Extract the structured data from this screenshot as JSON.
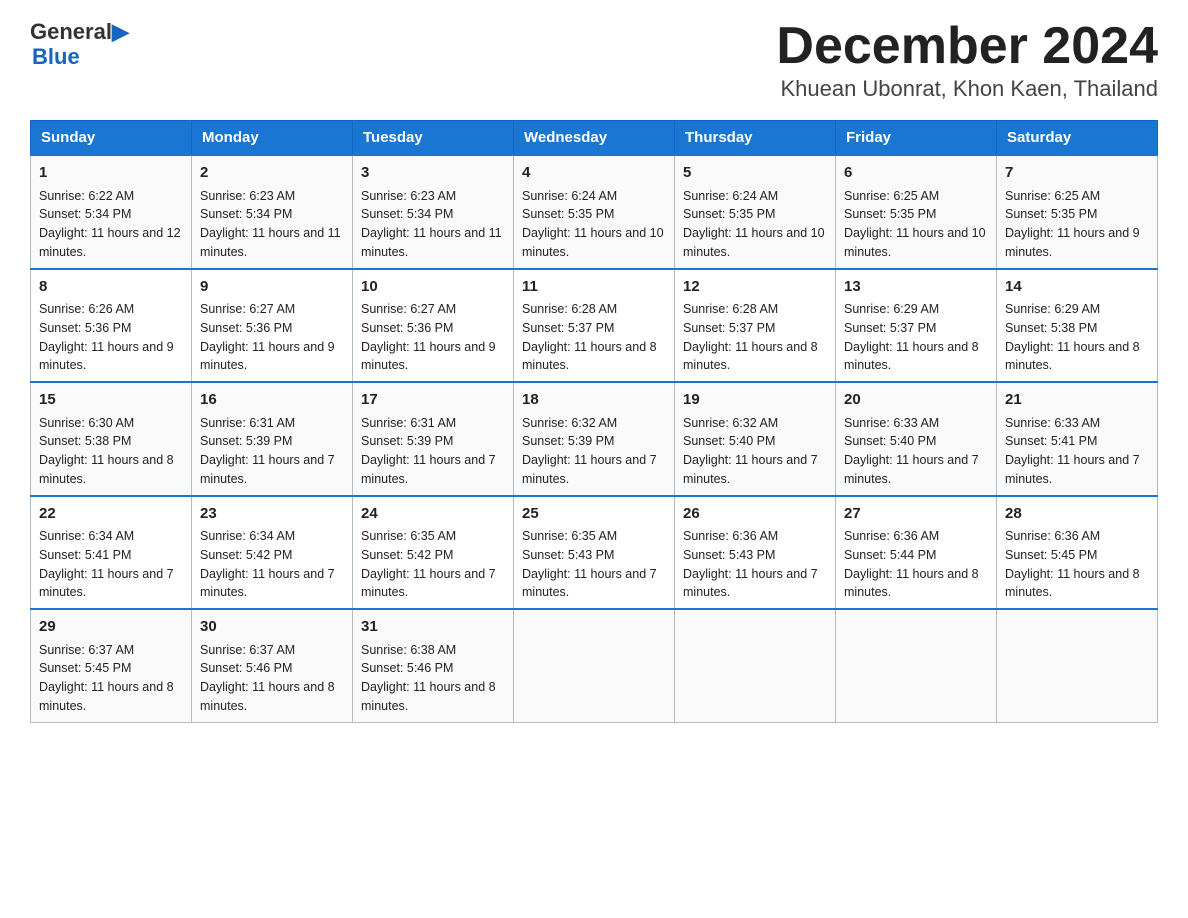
{
  "header": {
    "logo_line1": "General",
    "logo_line2": "Blue",
    "month_title": "December 2024",
    "location": "Khuean Ubonrat, Khon Kaen, Thailand"
  },
  "days_of_week": [
    "Sunday",
    "Monday",
    "Tuesday",
    "Wednesday",
    "Thursday",
    "Friday",
    "Saturday"
  ],
  "weeks": [
    [
      {
        "day": "1",
        "sunrise": "6:22 AM",
        "sunset": "5:34 PM",
        "daylight": "11 hours and 12 minutes."
      },
      {
        "day": "2",
        "sunrise": "6:23 AM",
        "sunset": "5:34 PM",
        "daylight": "11 hours and 11 minutes."
      },
      {
        "day": "3",
        "sunrise": "6:23 AM",
        "sunset": "5:34 PM",
        "daylight": "11 hours and 11 minutes."
      },
      {
        "day": "4",
        "sunrise": "6:24 AM",
        "sunset": "5:35 PM",
        "daylight": "11 hours and 10 minutes."
      },
      {
        "day": "5",
        "sunrise": "6:24 AM",
        "sunset": "5:35 PM",
        "daylight": "11 hours and 10 minutes."
      },
      {
        "day": "6",
        "sunrise": "6:25 AM",
        "sunset": "5:35 PM",
        "daylight": "11 hours and 10 minutes."
      },
      {
        "day": "7",
        "sunrise": "6:25 AM",
        "sunset": "5:35 PM",
        "daylight": "11 hours and 9 minutes."
      }
    ],
    [
      {
        "day": "8",
        "sunrise": "6:26 AM",
        "sunset": "5:36 PM",
        "daylight": "11 hours and 9 minutes."
      },
      {
        "day": "9",
        "sunrise": "6:27 AM",
        "sunset": "5:36 PM",
        "daylight": "11 hours and 9 minutes."
      },
      {
        "day": "10",
        "sunrise": "6:27 AM",
        "sunset": "5:36 PM",
        "daylight": "11 hours and 9 minutes."
      },
      {
        "day": "11",
        "sunrise": "6:28 AM",
        "sunset": "5:37 PM",
        "daylight": "11 hours and 8 minutes."
      },
      {
        "day": "12",
        "sunrise": "6:28 AM",
        "sunset": "5:37 PM",
        "daylight": "11 hours and 8 minutes."
      },
      {
        "day": "13",
        "sunrise": "6:29 AM",
        "sunset": "5:37 PM",
        "daylight": "11 hours and 8 minutes."
      },
      {
        "day": "14",
        "sunrise": "6:29 AM",
        "sunset": "5:38 PM",
        "daylight": "11 hours and 8 minutes."
      }
    ],
    [
      {
        "day": "15",
        "sunrise": "6:30 AM",
        "sunset": "5:38 PM",
        "daylight": "11 hours and 8 minutes."
      },
      {
        "day": "16",
        "sunrise": "6:31 AM",
        "sunset": "5:39 PM",
        "daylight": "11 hours and 7 minutes."
      },
      {
        "day": "17",
        "sunrise": "6:31 AM",
        "sunset": "5:39 PM",
        "daylight": "11 hours and 7 minutes."
      },
      {
        "day": "18",
        "sunrise": "6:32 AM",
        "sunset": "5:39 PM",
        "daylight": "11 hours and 7 minutes."
      },
      {
        "day": "19",
        "sunrise": "6:32 AM",
        "sunset": "5:40 PM",
        "daylight": "11 hours and 7 minutes."
      },
      {
        "day": "20",
        "sunrise": "6:33 AM",
        "sunset": "5:40 PM",
        "daylight": "11 hours and 7 minutes."
      },
      {
        "day": "21",
        "sunrise": "6:33 AM",
        "sunset": "5:41 PM",
        "daylight": "11 hours and 7 minutes."
      }
    ],
    [
      {
        "day": "22",
        "sunrise": "6:34 AM",
        "sunset": "5:41 PM",
        "daylight": "11 hours and 7 minutes."
      },
      {
        "day": "23",
        "sunrise": "6:34 AM",
        "sunset": "5:42 PM",
        "daylight": "11 hours and 7 minutes."
      },
      {
        "day": "24",
        "sunrise": "6:35 AM",
        "sunset": "5:42 PM",
        "daylight": "11 hours and 7 minutes."
      },
      {
        "day": "25",
        "sunrise": "6:35 AM",
        "sunset": "5:43 PM",
        "daylight": "11 hours and 7 minutes."
      },
      {
        "day": "26",
        "sunrise": "6:36 AM",
        "sunset": "5:43 PM",
        "daylight": "11 hours and 7 minutes."
      },
      {
        "day": "27",
        "sunrise": "6:36 AM",
        "sunset": "5:44 PM",
        "daylight": "11 hours and 8 minutes."
      },
      {
        "day": "28",
        "sunrise": "6:36 AM",
        "sunset": "5:45 PM",
        "daylight": "11 hours and 8 minutes."
      }
    ],
    [
      {
        "day": "29",
        "sunrise": "6:37 AM",
        "sunset": "5:45 PM",
        "daylight": "11 hours and 8 minutes."
      },
      {
        "day": "30",
        "sunrise": "6:37 AM",
        "sunset": "5:46 PM",
        "daylight": "11 hours and 8 minutes."
      },
      {
        "day": "31",
        "sunrise": "6:38 AM",
        "sunset": "5:46 PM",
        "daylight": "11 hours and 8 minutes."
      },
      null,
      null,
      null,
      null
    ]
  ]
}
